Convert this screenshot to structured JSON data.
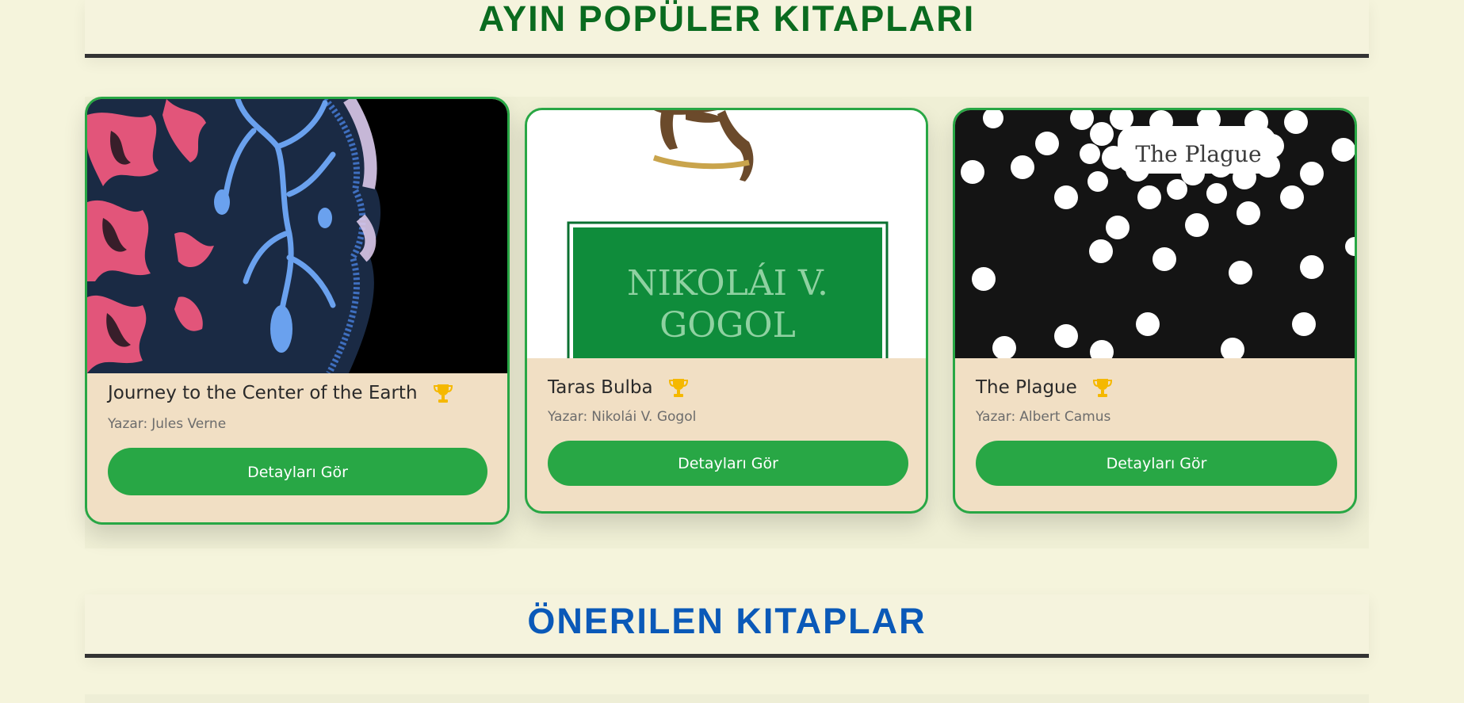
{
  "sections": {
    "popular_title": "AYIN POPÜLER KITAPLARI",
    "recommended_title": "ÖNERILEN KITAPLAR"
  },
  "books": [
    {
      "title": "Journey to the Center of the Earth",
      "author_label": "Yazar:",
      "author": "Jules Verne",
      "button": "Detayları Gör",
      "badge_icon": "trophy-icon"
    },
    {
      "title": "Taras Bulba",
      "author_label": "Yazar:",
      "author": "Nikolái V. Gogol",
      "button": "Detayları Gör",
      "badge_icon": "trophy-icon",
      "cover_text": [
        "NIKOLÁI V.",
        "GOGOL"
      ]
    },
    {
      "title": "The Plague",
      "author_label": "Yazar:",
      "author": "Albert Camus",
      "button": "Detayları Gör",
      "badge_icon": "trophy-icon",
      "cover_text": "The Plague"
    }
  ],
  "colors": {
    "page_background": "#f5f4dc",
    "popular_heading": "#0a6b1f",
    "recommended_heading": "#0a59b8",
    "card_background": "#f1dfc4",
    "accent_green": "#28a745",
    "trophy": "#f5b800"
  }
}
